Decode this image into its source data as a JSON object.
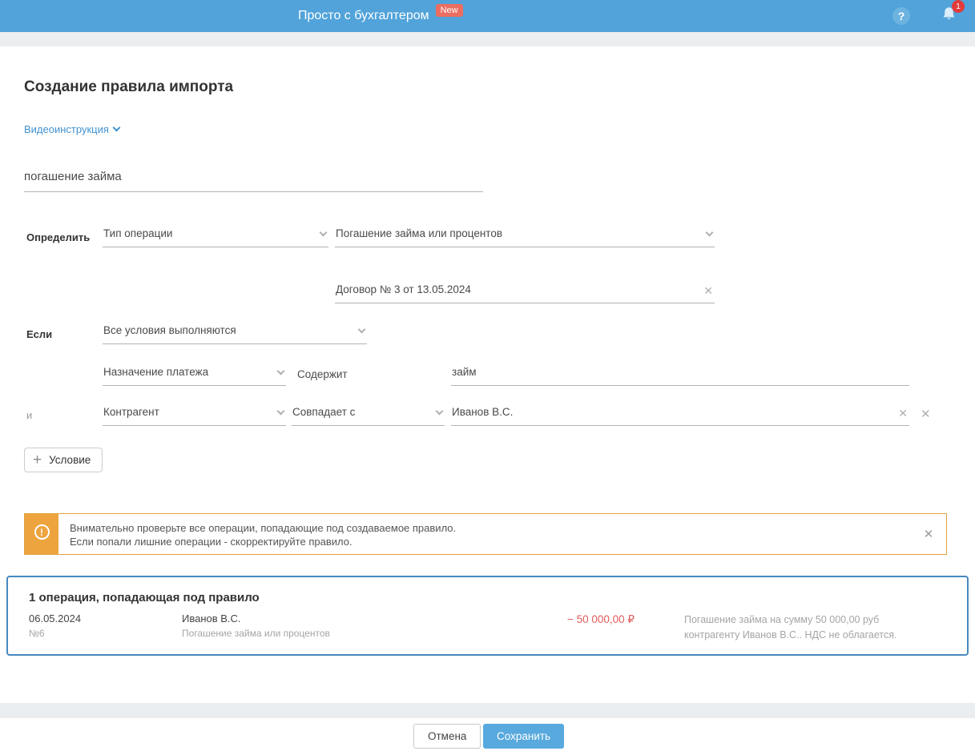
{
  "header": {
    "title": "Просто с бухгалтером",
    "badge": "New",
    "help_icon": "?",
    "notification_count": "1"
  },
  "page": {
    "title": "Создание правила импорта",
    "video_link": "Видеоинструкция"
  },
  "rule": {
    "name": "погашение займа"
  },
  "define": {
    "label": "Определить",
    "type_field": "Тип операции",
    "type_value": "Погашение займа или процентов",
    "contract": "Договор № 3 от 13.05.2024"
  },
  "conditions": {
    "label": "Если",
    "mode": "Все условия выполняются",
    "and_label": "и",
    "rows": [
      {
        "field": "Назначение платежа",
        "operator": "Содержит",
        "value": "займ"
      },
      {
        "field": "Контрагент",
        "operator": "Совпадает с",
        "value": "Иванов В.С."
      }
    ],
    "add_button": "Условие"
  },
  "warning": {
    "line1": "Внимательно проверьте все операции, попадающие под создаваемое правило.",
    "line2": "Если попали лишние операции - скорректируйте правило."
  },
  "operations": {
    "title": "1 операция, попадающая под правило",
    "rows": [
      {
        "date": "06.05.2024",
        "number": "№6",
        "counterparty": "Иванов В.С.",
        "type": "Погашение займа или процентов",
        "amount": "− 50 000,00 ₽",
        "description": "Погашение займа на сумму 50 000,00 руб контрагенту Иванов В.С.. НДС не облагается."
      }
    ]
  },
  "footer": {
    "cancel": "Отмена",
    "save": "Сохранить"
  },
  "icons": {
    "close": "✕",
    "plus": "+",
    "warning": "!"
  },
  "colors": {
    "header_blue": "#51a3da",
    "link_blue": "#4192d0",
    "panel_border_blue": "#4688c0",
    "warning_orange": "#eda43e",
    "new_badge_red": "#ec6e61",
    "notification_red": "#e23b3b",
    "amount_red": "#e05c5c",
    "save_button_blue": "#58a9de"
  }
}
